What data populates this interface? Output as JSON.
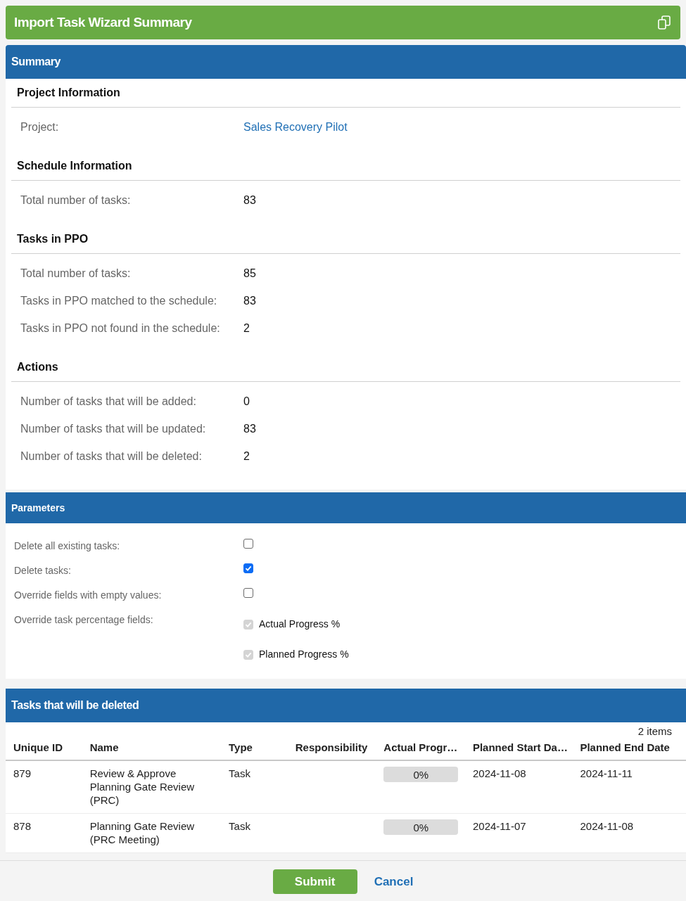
{
  "title": "Import Task Wizard Summary",
  "summary": {
    "title": "Summary",
    "groups": [
      {
        "heading": "Project Information",
        "rows": [
          {
            "label": "Project:",
            "value": "Sales Recovery Pilot",
            "kind": "link"
          }
        ]
      },
      {
        "heading": "Schedule Information",
        "rows": [
          {
            "label": "Total number of tasks:",
            "value": "83",
            "kind": "text"
          }
        ]
      },
      {
        "heading": "Tasks in PPO",
        "rows": [
          {
            "label": "Total number of tasks:",
            "value": "85",
            "kind": "text"
          },
          {
            "label": "Tasks in PPO matched to the schedule:",
            "value": "83",
            "kind": "text"
          },
          {
            "label": "Tasks in PPO not found in the schedule:",
            "value": "2",
            "kind": "text"
          }
        ]
      },
      {
        "heading": "Actions",
        "rows": [
          {
            "label": "Number of tasks that will be added:",
            "value": "0",
            "kind": "text"
          },
          {
            "label": "Number of tasks that will be updated:",
            "value": "83",
            "kind": "text"
          },
          {
            "label": "Number of tasks that will be deleted:",
            "value": "2",
            "kind": "text"
          }
        ]
      }
    ]
  },
  "parameters": {
    "title": "Parameters",
    "items": [
      {
        "label": "Delete all existing tasks:",
        "options": [
          {
            "checked": false,
            "disabled": false
          }
        ]
      },
      {
        "label": "Delete tasks:",
        "options": [
          {
            "checked": true,
            "disabled": false
          }
        ]
      },
      {
        "label": "Override fields with empty values:",
        "options": [
          {
            "checked": false,
            "disabled": false
          }
        ]
      },
      {
        "label": "Override task percentage fields:",
        "options": [
          {
            "label": "Actual Progress %",
            "checked": true,
            "disabled": true
          },
          {
            "label": "Planned Progress %",
            "checked": true,
            "disabled": true
          }
        ]
      }
    ]
  },
  "deleted_tasks": {
    "title": "Tasks that will be deleted",
    "count": "2 items",
    "columns": [
      "Unique ID",
      "Name",
      "Type",
      "Responsibility",
      "Actual Progr…",
      "Planned Start Da…",
      "Planned End Date"
    ],
    "rows": [
      {
        "id": "879",
        "name": "Review & Approve Planning Gate Review (PRC)",
        "type": "Task",
        "progress": "0%",
        "level": 0,
        "start": "2024-11-08",
        "end": "2024-11-11"
      },
      {
        "id": "878",
        "name": "Planning Gate Review (PRC Meeting)",
        "type": "Task",
        "progress": "0%",
        "level": 0,
        "start": "2024-11-07",
        "end": "2024-11-08"
      }
    ]
  },
  "buttons": {
    "submit": "Submit",
    "cancel": "Cancel"
  }
}
